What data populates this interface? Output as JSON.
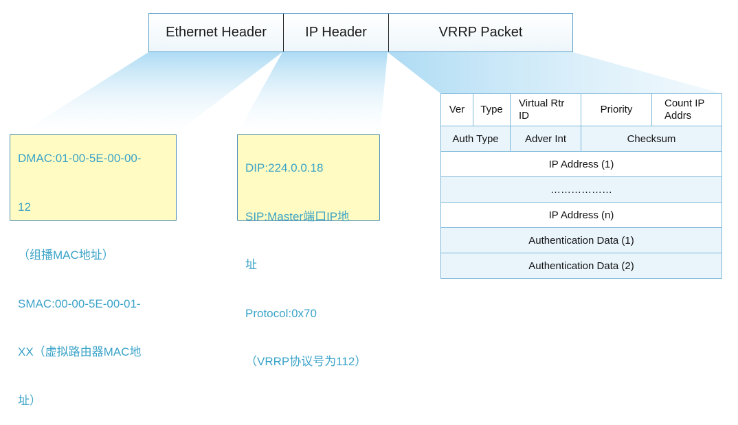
{
  "header": {
    "ethernet": "Ethernet Header",
    "ip": "IP Header",
    "vrrp": "VRRP Packet"
  },
  "ethernet_note": {
    "lines": [
      "DMAC:01-00-5E-00-00-",
      "12",
      "（组播MAC地址）",
      "SMAC:00-00-5E-00-01-",
      "XX（虚拟路由器MAC地",
      "址）"
    ]
  },
  "ip_note": {
    "lines": [
      "DIP:224.0.0.18",
      "SIP:Master端口IP地",
      "址",
      "Protocol:0x70",
      "（VRRP协议号为112）"
    ]
  },
  "packet": {
    "row0": [
      "Ver",
      "Type",
      "Virtual Rtr\nID",
      "Priority",
      "Count IP\nAddrs"
    ],
    "row1": [
      "Auth Type",
      "Adver Int",
      "Checksum"
    ],
    "ip_first": "IP Address (1)",
    "ellipsis": "………………",
    "ip_last": "IP Address (n)",
    "auth1": "Authentication Data (1)",
    "auth2": "Authentication Data (2)"
  },
  "colors": {
    "note_fill": "#fffbc2",
    "note_text": "#3aa3c8",
    "fan_light": "#bfe3f7",
    "table_border": "#7bb7d8"
  }
}
